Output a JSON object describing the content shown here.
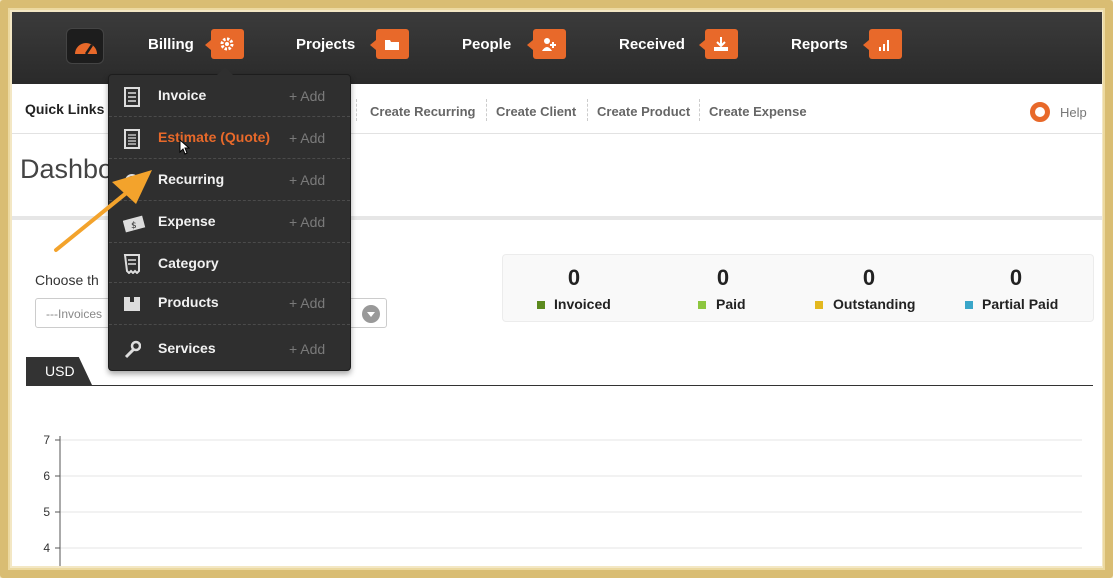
{
  "topnav": {
    "items": [
      {
        "label": "Billing",
        "icon": "gear-icon"
      },
      {
        "label": "Projects",
        "icon": "folder-icon"
      },
      {
        "label": "People",
        "icon": "add-person-icon"
      },
      {
        "label": "Received",
        "icon": "download-tray-icon"
      },
      {
        "label": "Reports",
        "icon": "bar-chart-icon"
      }
    ],
    "accent": "#e8692a"
  },
  "quicklinks": {
    "label": "Quick Links",
    "links": [
      "Create Recurring",
      "Create Client",
      "Create Product",
      "Create Expense"
    ],
    "help": "Help"
  },
  "page_title": "Dashbo",
  "filter": {
    "choose_label": "Choose th",
    "select_value": "---Invoices"
  },
  "stats": [
    {
      "value": "0",
      "label": "Invoiced",
      "color": "#5c8a1e"
    },
    {
      "value": "0",
      "label": "Paid",
      "color": "#8dc63f"
    },
    {
      "value": "0",
      "label": "Outstanding",
      "color": "#e3b81f"
    },
    {
      "value": "0",
      "label": "Partial Paid",
      "color": "#3aa6c9"
    }
  ],
  "currency_tab": "USD",
  "chart_data": {
    "type": "line",
    "y_ticks": [
      "7",
      "6",
      "5",
      "4"
    ],
    "series": []
  },
  "menu": {
    "items": [
      {
        "label": "Invoice",
        "add": "+ Add",
        "icon": "invoice-icon"
      },
      {
        "label": "Estimate (Quote)",
        "add": "+ Add",
        "icon": "estimate-icon",
        "active": true
      },
      {
        "label": "Recurring",
        "add": "+ Add",
        "icon": "recurring-icon"
      },
      {
        "label": "Expense",
        "add": "+ Add",
        "icon": "expense-icon"
      },
      {
        "label": "Category",
        "add": "",
        "icon": "category-icon"
      },
      {
        "label": "Products",
        "add": "+ Add",
        "icon": "products-icon"
      },
      {
        "label": "Services",
        "add": "+ Add",
        "icon": "wrench-icon"
      }
    ]
  }
}
